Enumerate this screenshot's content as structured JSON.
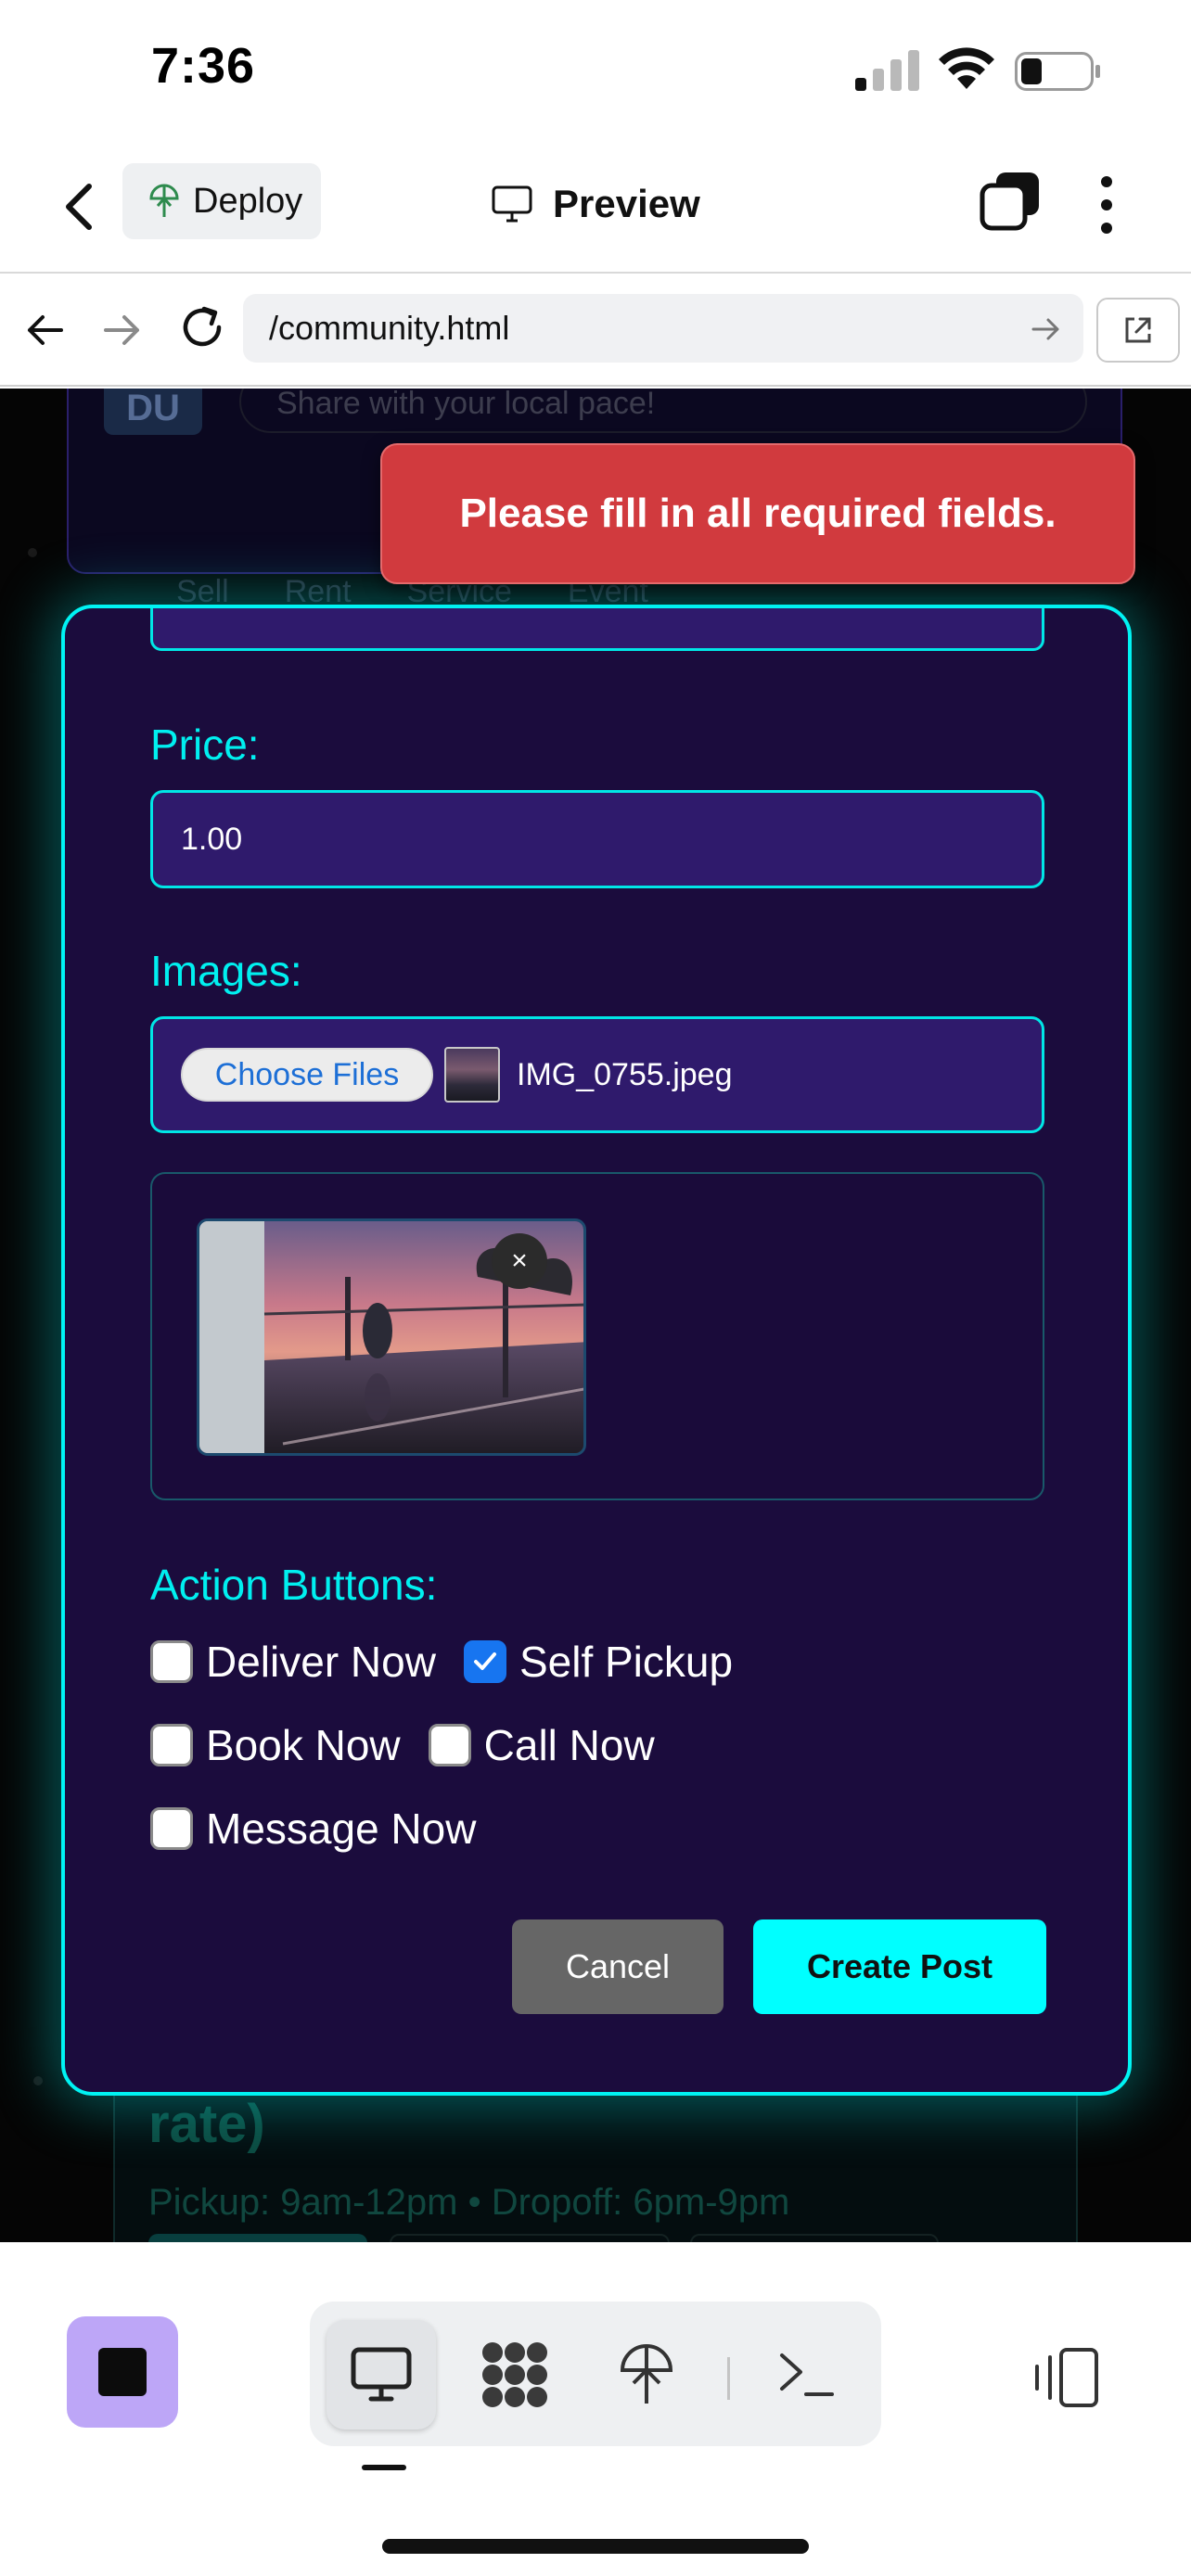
{
  "status_bar": {
    "time": "7:36"
  },
  "toolbar": {
    "deploy_label": "Deploy",
    "preview_label": "Preview"
  },
  "browser": {
    "url": "/community.html"
  },
  "background": {
    "avatar_initials": "DU",
    "composer_placeholder": "Share with your local pace!",
    "tabs": [
      "Sell",
      "Rent",
      "Service",
      "Event"
    ],
    "listing_heading": "rate)",
    "listing_schedule": "Pickup: 9am-12pm • Dropoff: 6pm-9pm"
  },
  "toast": {
    "message": "Please fill in all required fields."
  },
  "modal": {
    "price_label": "Price:",
    "price_value": "1.00",
    "images_label": "Images:",
    "choose_files_label": "Choose Files",
    "file_name": "IMG_0755.jpeg",
    "remove_image_label": "×",
    "action_buttons_label": "Action Buttons:",
    "actions": [
      {
        "label": "Deliver Now",
        "checked": false
      },
      {
        "label": "Self Pickup",
        "checked": true
      },
      {
        "label": "Book Now",
        "checked": false
      },
      {
        "label": "Call Now",
        "checked": false
      },
      {
        "label": "Message Now",
        "checked": false
      }
    ],
    "cancel_label": "Cancel",
    "create_label": "Create Post"
  },
  "colors": {
    "modal_bg": "#1b0c3d",
    "accent_cyan": "#00ffff",
    "toast_red": "#d13a3e",
    "checkbox_blue": "#1775f0",
    "stop_purple": "#bda6f7"
  },
  "dock": {
    "items": [
      "desktop-icon",
      "apps-icon",
      "deploy-icon",
      "terminal-icon"
    ],
    "active": "desktop-icon"
  }
}
